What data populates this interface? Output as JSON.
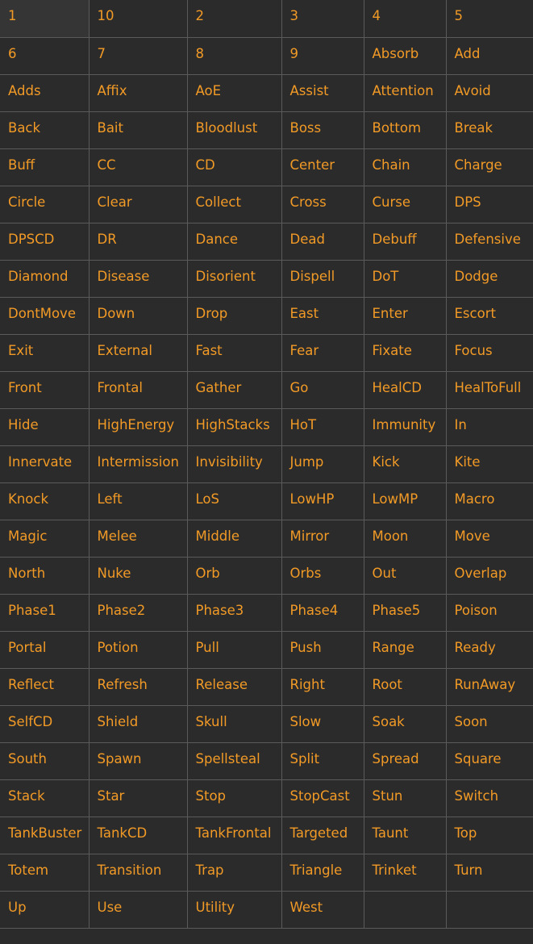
{
  "colors": {
    "background": "#2b2b2b",
    "text": "#f29a26",
    "border": "#5a5a5a"
  },
  "items": [
    "1",
    "10",
    "2",
    "3",
    "4",
    "5",
    "6",
    "7",
    "8",
    "9",
    "Absorb",
    "Add",
    "Adds",
    "Affix",
    "AoE",
    "Assist",
    "Attention",
    "Avoid",
    "Back",
    "Bait",
    "Bloodlust",
    "Boss",
    "Bottom",
    "Break",
    "Buff",
    "CC",
    "CD",
    "Center",
    "Chain",
    "Charge",
    "Circle",
    "Clear",
    "Collect",
    "Cross",
    "Curse",
    "DPS",
    "DPSCD",
    "DR",
    "Dance",
    "Dead",
    "Debuff",
    "Defensive",
    "Diamond",
    "Disease",
    "Disorient",
    "Dispell",
    "DoT",
    "Dodge",
    "DontMove",
    "Down",
    "Drop",
    "East",
    "Enter",
    "Escort",
    "Exit",
    "External",
    "Fast",
    "Fear",
    "Fixate",
    "Focus",
    "Front",
    "Frontal",
    "Gather",
    "Go",
    "HealCD",
    "HealToFull",
    "Hide",
    "HighEnergy",
    "HighStacks",
    "HoT",
    "Immunity",
    "In",
    "Innervate",
    "Intermission",
    "Invisibility",
    "Jump",
    "Kick",
    "Kite",
    "Knock",
    "Left",
    "LoS",
    "LowHP",
    "LowMP",
    "Macro",
    "Magic",
    "Melee",
    "Middle",
    "Mirror",
    "Moon",
    "Move",
    "North",
    "Nuke",
    "Orb",
    "Orbs",
    "Out",
    "Overlap",
    "Phase1",
    "Phase2",
    "Phase3",
    "Phase4",
    "Phase5",
    "Poison",
    "Portal",
    "Potion",
    "Pull",
    "Push",
    "Range",
    "Ready",
    "Reflect",
    "Refresh",
    "Release",
    "Right",
    "Root",
    "RunAway",
    "SelfCD",
    "Shield",
    "Skull",
    "Slow",
    "Soak",
    "Soon",
    "South",
    "Spawn",
    "Spellsteal",
    "Split",
    "Spread",
    "Square",
    "Stack",
    "Star",
    "Stop",
    "StopCast",
    "Stun",
    "Switch",
    "TankBuster",
    "TankCD",
    "TankFrontal",
    "Targeted",
    "Taunt",
    "Top",
    "Totem",
    "Transition",
    "Trap",
    "Triangle",
    "Trinket",
    "Turn",
    "Up",
    "Use",
    "Utility",
    "West"
  ]
}
